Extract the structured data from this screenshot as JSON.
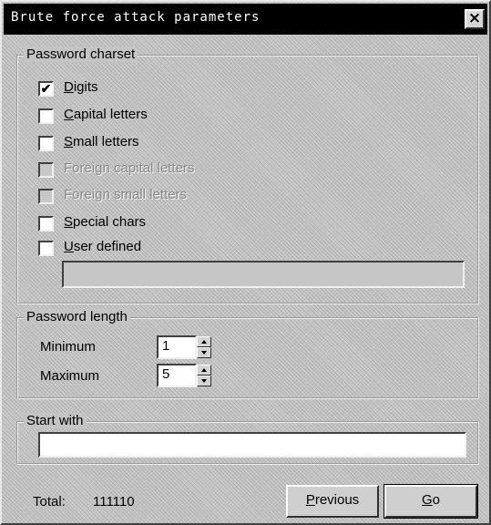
{
  "window": {
    "title": "Brute force attack parameters",
    "close_glyph": "×"
  },
  "charset": {
    "group_label": "Password charset",
    "items": [
      {
        "key": "D",
        "rest": "igits",
        "checked": true,
        "enabled": true
      },
      {
        "key": "C",
        "rest": "apital letters",
        "checked": false,
        "enabled": true
      },
      {
        "key": "S",
        "rest": "mall letters",
        "checked": false,
        "enabled": true
      },
      {
        "key": "F",
        "rest": "oreign capital letters",
        "checked": false,
        "enabled": false
      },
      {
        "key": "F",
        "rest": "oreign small letters",
        "checked": false,
        "enabled": false
      },
      {
        "key": "S",
        "rest": "pecial chars",
        "checked": false,
        "enabled": true
      },
      {
        "key": "U",
        "rest": "ser defined",
        "checked": false,
        "enabled": true
      }
    ],
    "user_defined_value": ""
  },
  "length": {
    "group_label": "Password length",
    "minimum_label": "Minimum",
    "minimum_value": "1",
    "maximum_label": "Maximum",
    "maximum_value": "5"
  },
  "start_with": {
    "group_label": "Start with",
    "value": ""
  },
  "footer": {
    "total_label": "Total:",
    "total_value": "111110",
    "previous_key": "P",
    "previous_rest": "revious",
    "go_key": "G",
    "go_rest": "o"
  },
  "checkmark": "✔"
}
